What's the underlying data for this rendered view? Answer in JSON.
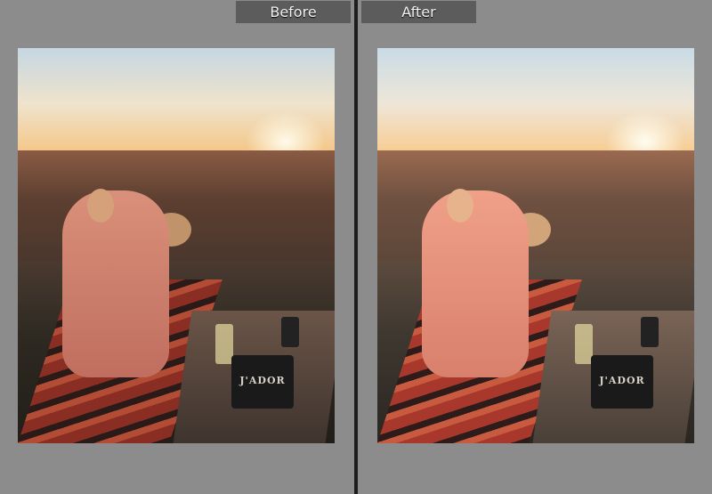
{
  "compare_view": {
    "before_label": "Before",
    "after_label": "After"
  },
  "bag_text": "J'ADOR"
}
